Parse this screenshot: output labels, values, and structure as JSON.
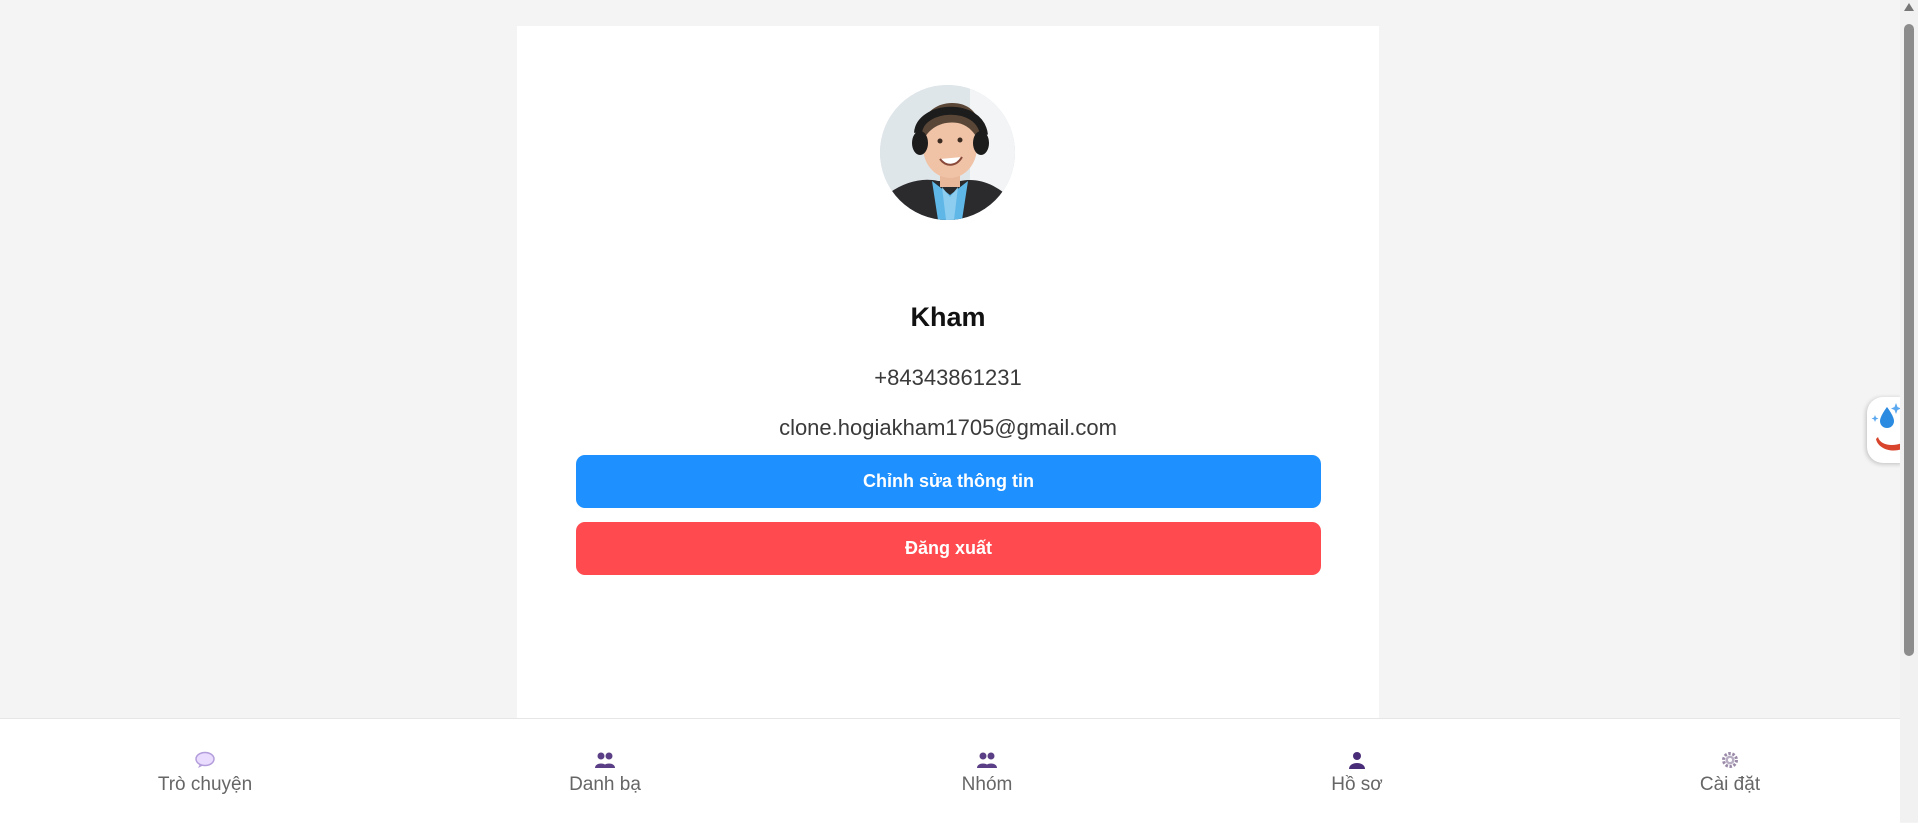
{
  "profile": {
    "name": "Kham",
    "phone": "+84343861231",
    "email": "clone.hogiakham1705@gmail.com",
    "avatar_icon": "user-photo"
  },
  "actions": {
    "edit_label": "Chỉnh sửa thông tin",
    "logout_label": "Đăng xuất"
  },
  "nav": {
    "items": [
      {
        "label": "Trò chuyện",
        "icon": "chat-icon"
      },
      {
        "label": "Danh bạ",
        "icon": "contacts-icon"
      },
      {
        "label": "Nhóm",
        "icon": "group-icon"
      },
      {
        "label": "Hồ sơ",
        "icon": "profile-icon"
      },
      {
        "label": "Cài đặt",
        "icon": "settings-icon"
      }
    ]
  },
  "colors": {
    "primary": "#1e90ff",
    "danger": "#ff4a4f",
    "nav_icon": "#5b3f86",
    "background": "#f4f4f4"
  }
}
